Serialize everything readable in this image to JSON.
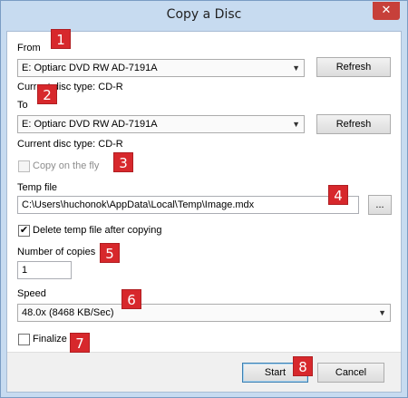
{
  "window": {
    "title": "Copy a Disc",
    "close_glyph": "✕"
  },
  "from": {
    "label": "From",
    "drive": "E: Optiarc DVD RW AD-7191A",
    "refresh_label": "Refresh",
    "disc_type": "Current disc type: CD-R"
  },
  "to": {
    "label": "To",
    "drive": "E: Optiarc DVD RW AD-7191A",
    "refresh_label": "Refresh",
    "disc_type": "Current disc type: CD-R"
  },
  "copy_on_the_fly": {
    "label": "Copy on the fly",
    "checked": false,
    "enabled": false
  },
  "temp_file": {
    "label": "Temp file",
    "value": "C:\\Users\\huchonok\\AppData\\Local\\Temp\\Image.mdx",
    "browse_label": "..."
  },
  "delete_temp": {
    "label": "Delete temp file after copying",
    "checked": true,
    "check_glyph": "✔"
  },
  "copies": {
    "label": "Number of copies",
    "value": "1"
  },
  "speed": {
    "label": "Speed",
    "value": "48.0x (8468 KB/Sec)"
  },
  "finalize": {
    "label": "Finalize",
    "checked": false
  },
  "buttons": {
    "start": "Start",
    "cancel": "Cancel"
  },
  "dropdown_arrow": "▼",
  "markers": [
    "1",
    "2",
    "3",
    "4",
    "5",
    "6",
    "7",
    "8"
  ],
  "colors": {
    "marker": "#d7282c",
    "titlebar": "#c7dbf0",
    "close": "#c7403a"
  }
}
